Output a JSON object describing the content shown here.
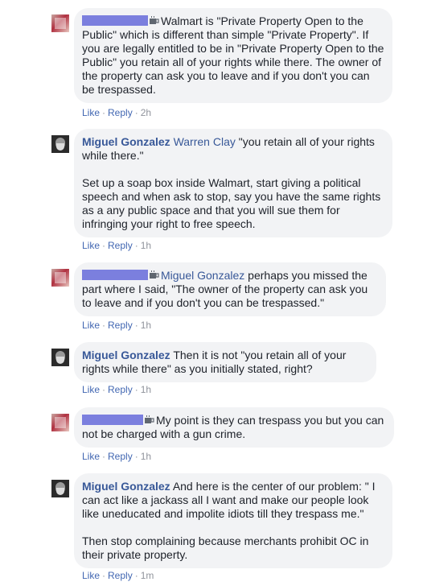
{
  "comments": [
    {
      "author": "",
      "author_redacted": true,
      "mention": "",
      "text": "Walmart is \"Private Property Open to the Public\" which is different than simple \"Private Property\". If you are legally entitled to be in \"Private Property Open to the Public\" you retain all of your rights while there. The owner of the property can ask you to leave and if you don't you can be trespassed.",
      "like_label": "Like",
      "reply_label": "Reply",
      "time": "2h"
    },
    {
      "author": "Miguel Gonzalez",
      "author_redacted": false,
      "mention": "Warren Clay",
      "text": "\"you retain all of your rights while there.\"\n\nSet up a soap box inside Walmart, start giving a political speech and when ask to stop, say you have the same rights as a any public space and that you will sue them for infringing your right to free speech.",
      "like_label": "Like",
      "reply_label": "Reply",
      "time": "1h"
    },
    {
      "author": "",
      "author_redacted": true,
      "mention": "Miguel Gonzalez",
      "text": "perhaps you missed the part where I said, \"The owner of the property can ask you to leave and if you don't you can be trespassed.\"",
      "like_label": "Like",
      "reply_label": "Reply",
      "time": "1h"
    },
    {
      "author": "Miguel Gonzalez",
      "author_redacted": false,
      "mention": "",
      "text": "Then it is not \"you retain all of your rights while there\" as you initially stated, right?",
      "like_label": "Like",
      "reply_label": "Reply",
      "time": "1h"
    },
    {
      "author": "",
      "author_redacted": true,
      "mention": "",
      "text": "My point is they can trespass you but you can not be charged with a gun crime.",
      "like_label": "Like",
      "reply_label": "Reply",
      "time": "1h"
    },
    {
      "author": "Miguel Gonzalez",
      "author_redacted": false,
      "mention": "",
      "text": "And here is the center of our problem: \" I can act like a jackass all I want and make our people look like uneducated and impolite idiots till they trespass me.\"\n\nThen stop complaining because merchants prohibit OC in their private property.",
      "like_label": "Like",
      "reply_label": "Reply",
      "time": "1m"
    }
  ],
  "colors": {
    "bubble": "#f2f3f5",
    "link": "#4267b2",
    "author": "#385898",
    "redaction": "#7b7fde",
    "meta": "#90949c"
  },
  "icons": {
    "redacted_badge": "coffee-cup-icon"
  }
}
